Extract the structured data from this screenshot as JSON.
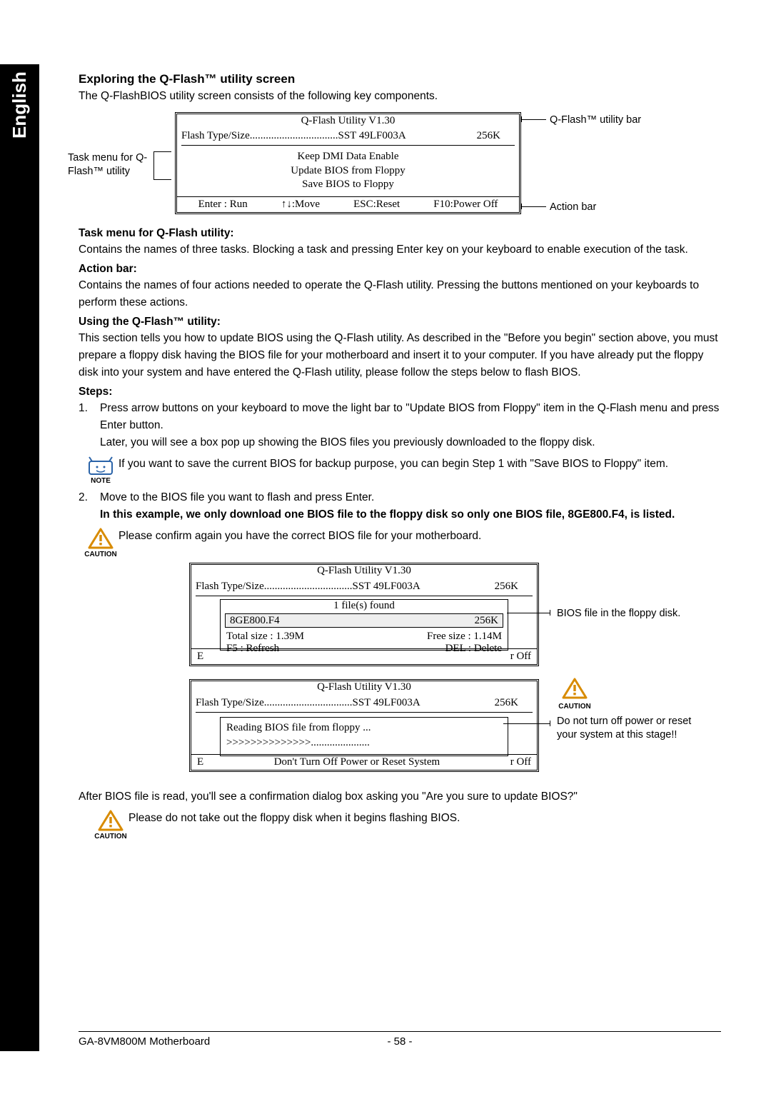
{
  "lang_tab": "English",
  "heading_exploring": "Exploring the Q-Flash™ utility screen",
  "para_exploring": "The Q-FlashBIOS utility screen consists of the following key components.",
  "diagram1": {
    "title": "Q-Flash Utility V1.30",
    "flash_label": "Flash Type/Size.................................SST 49LF003A",
    "flash_size": "256K",
    "task1": "Keep DMI Data    Enable",
    "task2": "Update BIOS from Floppy",
    "task3": "Save BIOS to Floppy",
    "action1": "Enter : Run",
    "action2": "↑↓:Move",
    "action3": "ESC:Reset",
    "action4": "F10:Power Off",
    "callout_left": "Task menu for Q-Flash™ utility",
    "callout_right_top": "Q-Flash™ utility bar",
    "callout_right_bottom": "Action bar"
  },
  "heading_taskmenu": "Task menu for Q-Flash utility:",
  "para_taskmenu": "Contains the names of three tasks. Blocking a task and pressing Enter key on your keyboard to enable execution of the task.",
  "heading_actionbar": "Action bar:",
  "para_actionbar": "Contains the names of four actions needed to operate the Q-Flash utility. Pressing the buttons mentioned on your keyboards to perform these actions.",
  "heading_using": "Using the Q-Flash™ utility:",
  "para_using": "This section tells you how to update BIOS using the Q-Flash utility. As described in the \"Before you begin\" section above, you must prepare a floppy disk having the BIOS file for your motherboard and insert it to your computer. If you have already put the floppy disk into your system and have entered the Q-Flash utility, please follow the steps below to flash BIOS.",
  "heading_steps": "Steps:",
  "step1_num": "1.",
  "step1_a": "Press arrow buttons on your keyboard to move the light bar to \"Update BIOS from Floppy\" item in the Q-Flash menu and press Enter button.",
  "step1_b": "Later, you will see a box pop up showing the BIOS files you previously downloaded to the floppy disk.",
  "note1_label": "NOTE",
  "note1_text": "If you want to save the current BIOS for backup purpose, you can begin Step 1 with \"Save BIOS to Floppy\" item.",
  "step2_num": "2.",
  "step2_a": "Move to the BIOS file you want to flash and press Enter.",
  "step2_b": "In this example, we only download one BIOS file to the floppy disk so only one BIOS file, 8GE800.F4, is listed.",
  "caution1_label": "CAUTION",
  "caution1_text": "Please confirm again you have the correct BIOS file for your motherboard.",
  "diagram2": {
    "title": "Q-Flash Utility V1.30",
    "flash_label": "Flash Type/Size.................................SST 49LF003A",
    "flash_size": "256K",
    "files_found": "1 file(s) found",
    "file_name": "8GE800.F4",
    "file_size": "256K",
    "total_size": "Total size : 1.39M",
    "free_size": "Free size : 1.14M",
    "f5": "F5 : Refresh",
    "del": "DEL : Delete",
    "bot_left": "E",
    "bot_right": "r Off",
    "callout_right": "BIOS file in the floppy disk."
  },
  "diagram3": {
    "title": "Q-Flash Utility V1.30",
    "flash_label": "Flash Type/Size.................................SST 49LF003A",
    "flash_size": "256K",
    "reading": "Reading BIOS file from floppy ...",
    "progress": ">>>>>>>>>>>>>>......................",
    "warn": "Don't Turn Off Power or Reset System",
    "bot_left": "E",
    "bot_right": "r Off",
    "callout_right": "Do not turn off power or reset your system at this stage!!",
    "caution_label": "CAUTION"
  },
  "para_after": "After BIOS file is read, you'll see a confirmation dialog box asking you \"Are you sure to update BIOS?\"",
  "caution2_label": "CAUTION",
  "caution2_text": "Please do not take out the floppy disk when it begins flashing BIOS.",
  "footer_left": "GA-8VM800M Motherboard",
  "footer_center": "- 58 -"
}
